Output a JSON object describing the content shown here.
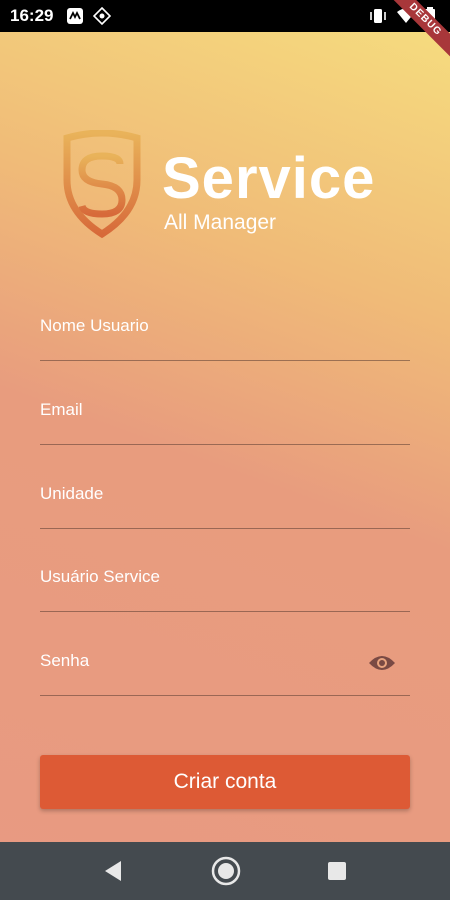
{
  "status_bar": {
    "time": "16:29",
    "debug_label": "DEBUG"
  },
  "brand": {
    "title": "Service",
    "subtitle": "All Manager"
  },
  "form": {
    "fields": [
      {
        "label": "Nome Usuario"
      },
      {
        "label": "Email"
      },
      {
        "label": "Unidade"
      },
      {
        "label": "Usuário Service"
      },
      {
        "label": "Senha"
      }
    ],
    "submit_label": "Criar conta"
  },
  "colors": {
    "button": "#dd5a35",
    "gradient_top": "#f6df7f",
    "gradient_bottom": "#e89a82",
    "navbar": "#444a4f"
  },
  "icons": {
    "password_toggle": "eye-icon",
    "nav_back": "back-triangle-icon",
    "nav_home": "home-circle-icon",
    "nav_recents": "recents-square-icon"
  }
}
